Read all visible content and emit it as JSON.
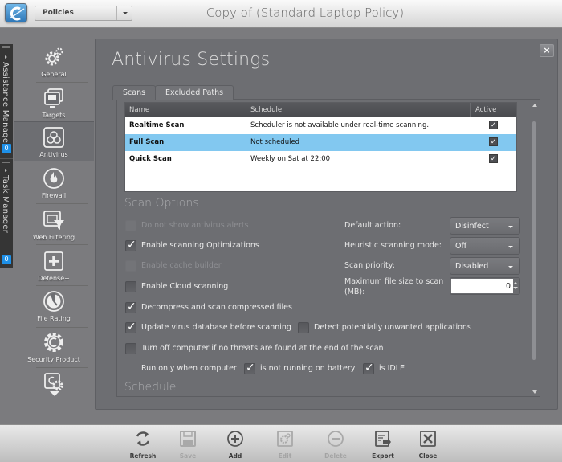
{
  "window": {
    "title": "Copy of (Standard Laptop Policy)",
    "policies_select": "Policies"
  },
  "side_tabs": [
    {
      "label": "Assistance Manager",
      "badge": "0"
    },
    {
      "label": "Task Manager",
      "badge": "0"
    }
  ],
  "nav": {
    "items": [
      {
        "label": "General",
        "icon": "gears-icon",
        "active": false
      },
      {
        "label": "Targets",
        "icon": "monitors-icon",
        "active": false
      },
      {
        "label": "Antivirus",
        "icon": "biohazard-icon",
        "active": true
      },
      {
        "label": "Firewall",
        "icon": "flame-icon",
        "active": false
      },
      {
        "label": "Web Filtering",
        "icon": "web-filter-icon",
        "active": false
      },
      {
        "label": "Defense+",
        "icon": "plus-box-icon",
        "active": false
      },
      {
        "label": "File Rating",
        "icon": "clock-dial-icon",
        "active": false
      },
      {
        "label": "Security Product",
        "icon": "comodo-gear-icon",
        "active": false
      },
      {
        "label": "",
        "icon": "settings-screen-icon",
        "active": false
      }
    ]
  },
  "panel": {
    "title": "Antivirus Settings",
    "close": "×",
    "tabs": [
      {
        "label": "Scans",
        "active": true
      },
      {
        "label": "Excluded Paths",
        "active": false
      }
    ],
    "table": {
      "columns": [
        "Name",
        "Schedule",
        "Active"
      ],
      "rows": [
        {
          "name": "Realtime Scan",
          "schedule": "Scheduler is not available under real-time scanning.",
          "active": true,
          "selected": false
        },
        {
          "name": "Full Scan",
          "schedule": "Not scheduled",
          "active": true,
          "selected": true
        },
        {
          "name": "Quick Scan",
          "schedule": "Weekly on Sat at 22:00",
          "active": true,
          "selected": false
        }
      ]
    },
    "scan_options": {
      "title": "Scan Options",
      "checkboxes": [
        {
          "label": "Do not show antivirus alerts",
          "checked": false,
          "disabled": true
        },
        {
          "label": "Enable scanning Optimizations",
          "checked": true,
          "disabled": false
        },
        {
          "label": "Enable cache builder",
          "checked": false,
          "disabled": true
        },
        {
          "label": "Enable Cloud scanning",
          "checked": false,
          "disabled": false
        },
        {
          "label": "Decompress and scan compressed files",
          "checked": true,
          "disabled": false
        },
        {
          "label": "Update virus database before scanning",
          "checked": true,
          "disabled": false
        },
        {
          "label": "Detect potentially unwanted applications",
          "checked": false,
          "disabled": false
        },
        {
          "label": "Turn off computer if no threats are found at the end of the scan",
          "checked": false,
          "disabled": false
        }
      ],
      "run_only_label": "Run only when computer",
      "run_only": [
        {
          "label": "is not running on battery",
          "checked": true
        },
        {
          "label": "is IDLE",
          "checked": true
        }
      ],
      "fields": {
        "default_action": {
          "label": "Default action:",
          "value": "Disinfect"
        },
        "heuristic_mode": {
          "label": "Heuristic scanning mode:",
          "value": "Off"
        },
        "scan_priority": {
          "label": "Scan priority:",
          "value": "Disabled"
        },
        "max_file_size": {
          "label_line1": "Maximum file size to scan",
          "label_line2": "(MB):",
          "value": "0"
        }
      }
    },
    "schedule": {
      "title": "Schedule"
    }
  },
  "toolbar": {
    "buttons": [
      {
        "label": "Refresh",
        "icon": "refresh-icon",
        "enabled": true
      },
      {
        "label": "Save",
        "icon": "save-icon",
        "enabled": false
      },
      {
        "label": "Add",
        "icon": "add-icon",
        "enabled": true
      },
      {
        "label": "Edit",
        "icon": "edit-icon",
        "enabled": false
      },
      {
        "label": "Delete",
        "icon": "delete-icon",
        "enabled": false
      },
      {
        "label": "Export",
        "icon": "export-icon",
        "enabled": true
      },
      {
        "label": "Close",
        "icon": "close-icon",
        "enabled": true
      }
    ]
  }
}
